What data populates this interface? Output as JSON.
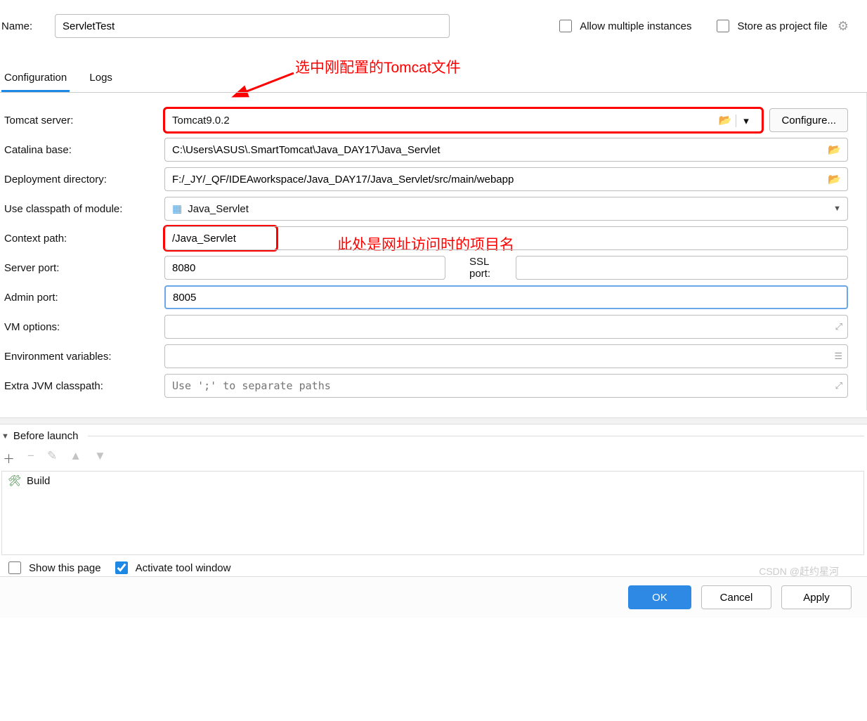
{
  "top": {
    "name_label": "Name:",
    "name_value": "ServletTest",
    "allow_multiple_label": "Allow multiple instances",
    "store_label": "Store as project file"
  },
  "annotations": {
    "a1": "选中刚配置的Tomcat文件",
    "a2": "此处是网址访问时的项目名"
  },
  "tabs": {
    "configuration": "Configuration",
    "logs": "Logs"
  },
  "form": {
    "tomcat_server_label": "Tomcat server:",
    "tomcat_server_value": "Tomcat9.0.2",
    "configure_btn": "Configure...",
    "catalina_label": "Catalina base:",
    "catalina_value": "C:\\Users\\ASUS\\.SmartTomcat\\Java_DAY17\\Java_Servlet",
    "deploy_label": "Deployment directory:",
    "deploy_value": "F:/_JY/_QF/IDEAworkspace/Java_DAY17/Java_Servlet/src/main/webapp",
    "classpath_label": "Use classpath of module:",
    "classpath_value": "Java_Servlet",
    "context_label": "Context path:",
    "context_value": "/Java_Servlet",
    "server_port_label": "Server port:",
    "server_port_value": "8080",
    "ssl_port_label": "SSL port:",
    "ssl_port_value": "",
    "admin_port_label": "Admin port:",
    "admin_port_value": "8005",
    "vm_options_label": "VM options:",
    "vm_options_value": "",
    "env_label": "Environment variables:",
    "env_value": "",
    "jvm_label": "Extra JVM classpath:",
    "jvm_placeholder": "Use ';' to separate paths"
  },
  "before_launch": {
    "title": "Before launch",
    "build_item": "Build"
  },
  "options": {
    "show_page": "Show this page",
    "activate_tool": "Activate tool window"
  },
  "footer": {
    "ok": "OK",
    "cancel": "Cancel",
    "apply": "Apply"
  },
  "watermark": "CSDN @赶约星河"
}
